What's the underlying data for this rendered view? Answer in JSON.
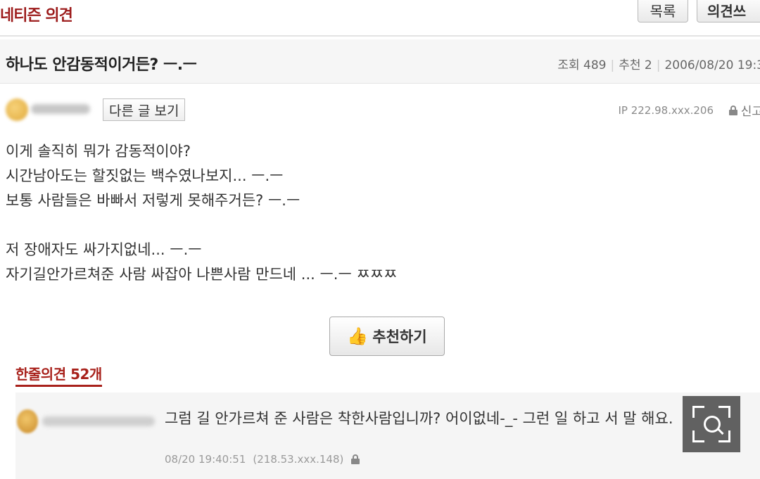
{
  "header": {
    "section_title": "네티즌 의견",
    "list_button": "목록",
    "write_button": "의견쓰"
  },
  "post": {
    "title": "하나도 안감동적이거든? ㅡ.ㅡ",
    "views_label": "조회",
    "views": "489",
    "recommends_label": "추천",
    "recommends": "2",
    "date": "2006/08/20 19:3",
    "other_posts_button": "다른 글 보기",
    "ip": "IP 222.98.xxx.206",
    "report_label": "신고",
    "body_lines": [
      "이게 솔직히 뭐가 감동적이야?",
      "시간남아도는 할짓없는 백수였나보지... ㅡ.ㅡ",
      "보통 사람들은 바빠서 저렇게 못해주거든? ㅡ.ㅡ",
      "",
      "저 장애자도 싸가지없네... ㅡ.ㅡ",
      "자기길안가르쳐준 사람 싸잡아 나쁜사람 만드네 ... ㅡ.ㅡ ㅉㅉㅉ"
    ],
    "recommend_button": "추천하기"
  },
  "comments": {
    "title": "한줄의견 52개",
    "items": [
      {
        "text": "그럼 길 안가르쳐 준 사람은 착한사람입니까? 어이없네-_- 그런 일 하고 서 말 해요.",
        "datetime": "08/20 19:40:51",
        "ip": "(218.53.xxx.148)"
      }
    ]
  },
  "icons": {
    "thumb": "thumbs-up-icon",
    "report": "lock-icon",
    "zoom": "zoom-search-icon"
  }
}
